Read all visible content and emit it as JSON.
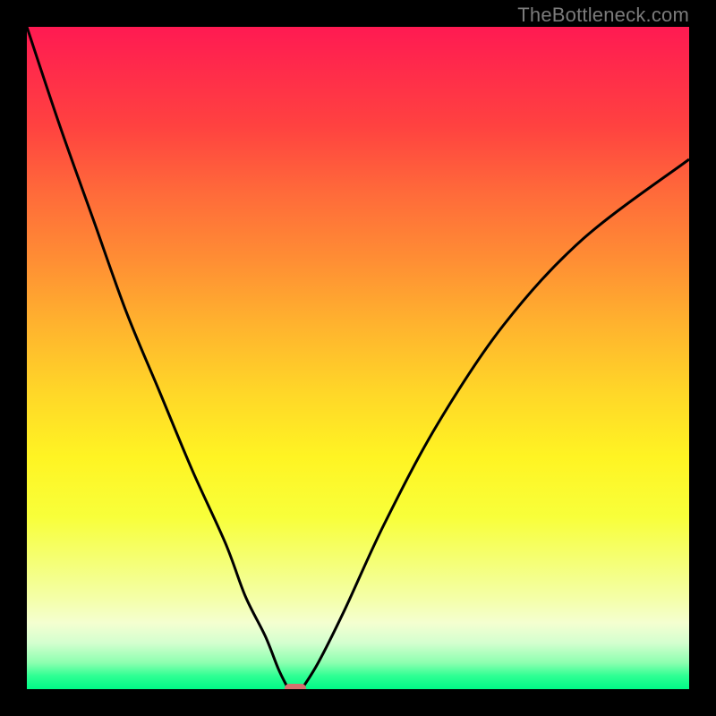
{
  "watermark": {
    "text": "TheBottleneck.com"
  },
  "chart_data": {
    "type": "line",
    "title": "",
    "xlabel": "",
    "ylabel": "",
    "xlim": [
      0,
      100
    ],
    "ylim": [
      0,
      100
    ],
    "grid": false,
    "legend": false,
    "background_gradient": {
      "direction": "vertical",
      "stops": [
        {
          "pos": 0,
          "color": "#ff1a52"
        },
        {
          "pos": 50,
          "color": "#ffd628"
        },
        {
          "pos": 75,
          "color": "#f8ff3a"
        },
        {
          "pos": 100,
          "color": "#00f987"
        }
      ]
    },
    "series": [
      {
        "name": "left-branch",
        "color": "#000000",
        "x": [
          0,
          5,
          10,
          15,
          20,
          25,
          30,
          33,
          36,
          38,
          39.5
        ],
        "y": [
          100,
          85,
          71,
          57,
          45,
          33,
          22,
          14,
          8,
          3,
          0
        ]
      },
      {
        "name": "right-branch",
        "color": "#000000",
        "x": [
          41.5,
          44,
          48,
          54,
          62,
          72,
          84,
          100
        ],
        "y": [
          0,
          4,
          12,
          25,
          40,
          55,
          68,
          80
        ]
      }
    ],
    "marker": {
      "x": 40.5,
      "y": 0,
      "color": "#d6706e",
      "shape": "pill"
    }
  }
}
